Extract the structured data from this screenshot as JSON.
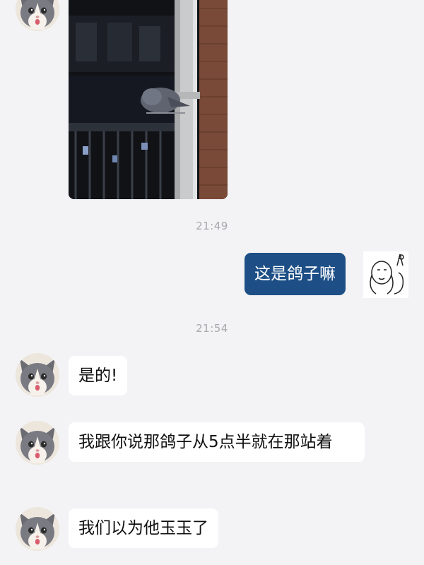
{
  "messages": [
    {
      "type": "image",
      "sender": "other",
      "content": "pigeon-on-pole-photo"
    },
    {
      "type": "time",
      "text": "21:49"
    },
    {
      "type": "text",
      "sender": "me",
      "text": "这是鸽子嘛"
    },
    {
      "type": "time",
      "text": "21:54"
    },
    {
      "type": "text",
      "sender": "other",
      "text": "是的!"
    },
    {
      "type": "text",
      "sender": "other",
      "text": "我跟你说那鸽子从5点半就在那站着"
    },
    {
      "type": "text",
      "sender": "other",
      "text": "我们以为他玉玉了"
    }
  ],
  "colors": {
    "background": "#f3f3f5",
    "incoming_bubble": "#ffffff",
    "outgoing_bubble": "#1d4f86",
    "timestamp": "#a8a8ad"
  },
  "icons": {
    "other_avatar": "cat-avatar-icon",
    "my_avatar": "meme-face-avatar-icon"
  }
}
